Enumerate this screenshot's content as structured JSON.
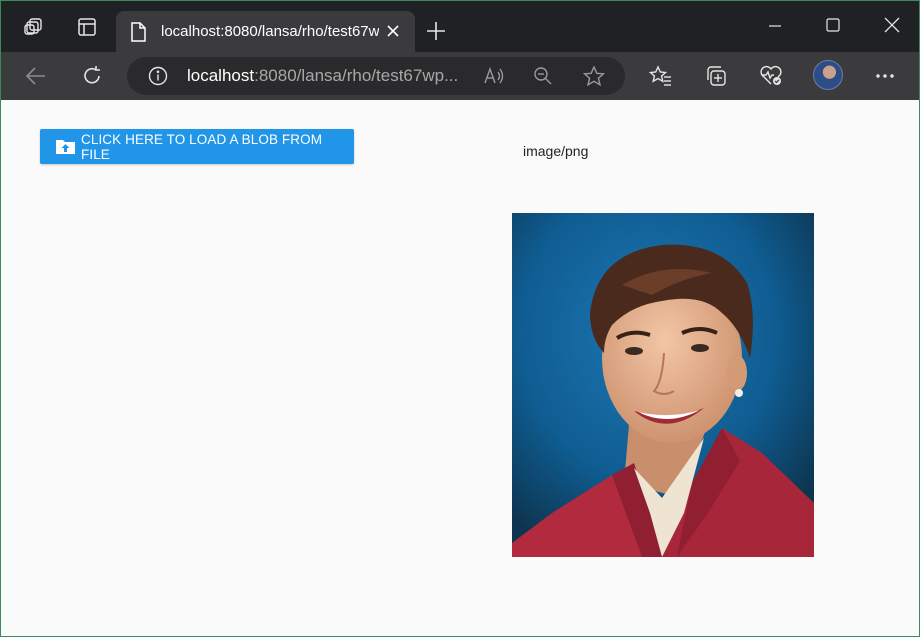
{
  "browser": {
    "tab_title": "localhost:8080/lansa/rho/test67w",
    "address_host": "localhost",
    "address_rest": ":8080/lansa/rho/test67wp..."
  },
  "page": {
    "load_button_label": "CLICK HERE TO LOAD A BLOB FROM FILE",
    "mime_type": "image/png"
  },
  "colors": {
    "accent": "#2196e8",
    "tabbar": "#202124",
    "toolbar": "#3b3b3e"
  },
  "icons": [
    "workspaces-icon",
    "tab-actions-icon",
    "page-icon",
    "close-icon",
    "new-tab-icon",
    "minimize-icon",
    "maximize-icon",
    "window-close-icon",
    "back-icon",
    "refresh-icon",
    "info-icon",
    "read-aloud-icon",
    "zoom-out-icon",
    "favorite-icon",
    "favorites-icon",
    "collections-icon",
    "browser-essentials-icon",
    "more-icon",
    "upload-folder-icon"
  ]
}
